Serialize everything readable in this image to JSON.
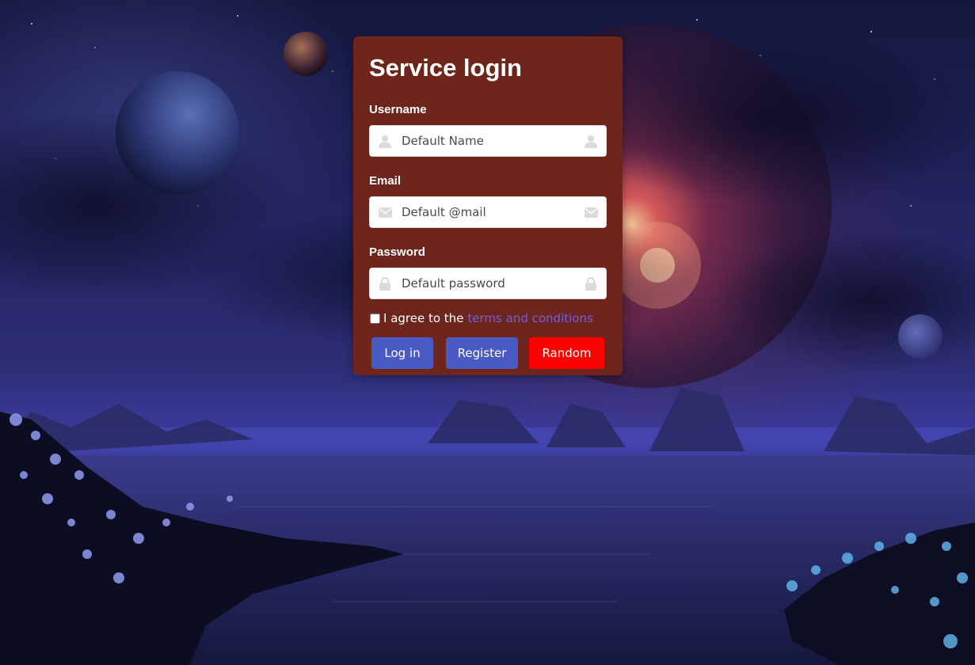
{
  "form": {
    "title": "Service login",
    "username": {
      "label": "Username",
      "placeholder": "Default Name"
    },
    "email": {
      "label": "Email",
      "placeholder": "Default @mail"
    },
    "password": {
      "label": "Password",
      "placeholder": "Default password"
    },
    "agree": {
      "text": "I agree to the",
      "link_text": "terms and conditions",
      "checked": false
    },
    "buttons": {
      "login": "Log in",
      "register": "Register",
      "random": "Random"
    }
  },
  "icons": {
    "username_left": "user-icon",
    "username_right": "user-icon",
    "email_left": "envelope-icon",
    "email_right": "envelope-icon",
    "password_left": "lock-icon",
    "password_right": "lock-icon"
  },
  "colors": {
    "card_background": "#6e261c",
    "primary_button": "#4a5ac5",
    "random_button": "#ff0000",
    "link": "#6f5ee0"
  }
}
